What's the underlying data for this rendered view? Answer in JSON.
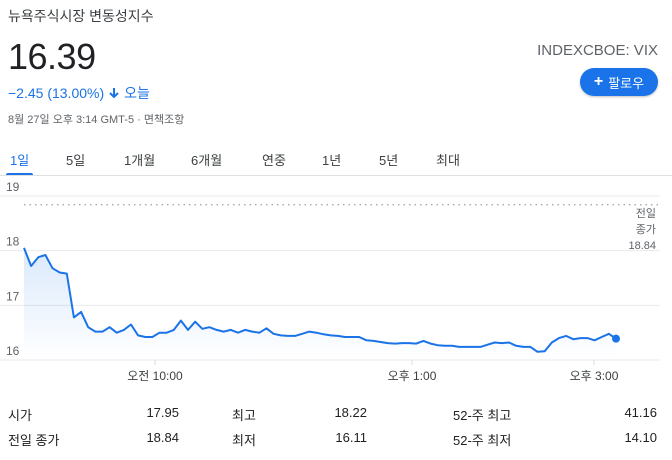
{
  "header": {
    "title": "뉴욕주식시장 변동성지수",
    "price": "16.39",
    "change": "−2.45 (13.00%)",
    "change_period": "오늘",
    "meta": "8월 27일 오후 3:14 GMT-5 · 면책조항",
    "ticker": "INDEXCBOE: VIX",
    "follow_label": "팔로우"
  },
  "tabs": [
    {
      "label": "1일",
      "active": true
    },
    {
      "label": "5일",
      "active": false
    },
    {
      "label": "1개월",
      "active": false
    },
    {
      "label": "6개월",
      "active": false
    },
    {
      "label": "연중",
      "active": false
    },
    {
      "label": "1년",
      "active": false
    },
    {
      "label": "5년",
      "active": false
    },
    {
      "label": "최대",
      "active": false
    }
  ],
  "chart_data": {
    "type": "line",
    "y_ticks": [
      "19",
      "18",
      "17",
      "16"
    ],
    "ylim": [
      16,
      19
    ],
    "x_ticks": [
      "오전 10:00",
      "오후 1:00",
      "오후 3:00"
    ],
    "previous_close_label": [
      "전일",
      "종가",
      "18.84"
    ],
    "previous_close": 18.84,
    "line_color": "#1a73e8",
    "values": [
      18.05,
      17.72,
      17.88,
      17.92,
      17.68,
      17.6,
      17.58,
      16.78,
      16.88,
      16.6,
      16.52,
      16.52,
      16.6,
      16.5,
      16.55,
      16.65,
      16.45,
      16.42,
      16.42,
      16.5,
      16.5,
      16.55,
      16.72,
      16.55,
      16.7,
      16.57,
      16.6,
      16.55,
      16.52,
      16.55,
      16.5,
      16.55,
      16.52,
      16.5,
      16.58,
      16.48,
      16.45,
      16.44,
      16.44,
      16.48,
      16.52,
      16.5,
      16.47,
      16.45,
      16.44,
      16.42,
      16.42,
      16.42,
      16.36,
      16.35,
      16.33,
      16.31,
      16.3,
      16.31,
      16.31,
      16.3,
      16.35,
      16.3,
      16.27,
      16.26,
      16.26,
      16.24,
      16.24,
      16.24,
      16.24,
      16.28,
      16.32,
      16.31,
      16.32,
      16.26,
      16.24,
      16.24,
      16.15,
      16.16,
      16.32,
      16.4,
      16.44,
      16.38,
      16.4,
      16.4,
      16.36,
      16.42,
      16.48,
      16.39
    ]
  },
  "stats": [
    {
      "label": "시가",
      "value": "17.95"
    },
    {
      "label": "최고",
      "value": "18.22"
    },
    {
      "label": "52-주 최고",
      "value": "41.16"
    },
    {
      "label": "전일 종가",
      "value": "18.84"
    },
    {
      "label": "최저",
      "value": "16.11"
    },
    {
      "label": "52-주 최저",
      "value": "14.10"
    }
  ]
}
